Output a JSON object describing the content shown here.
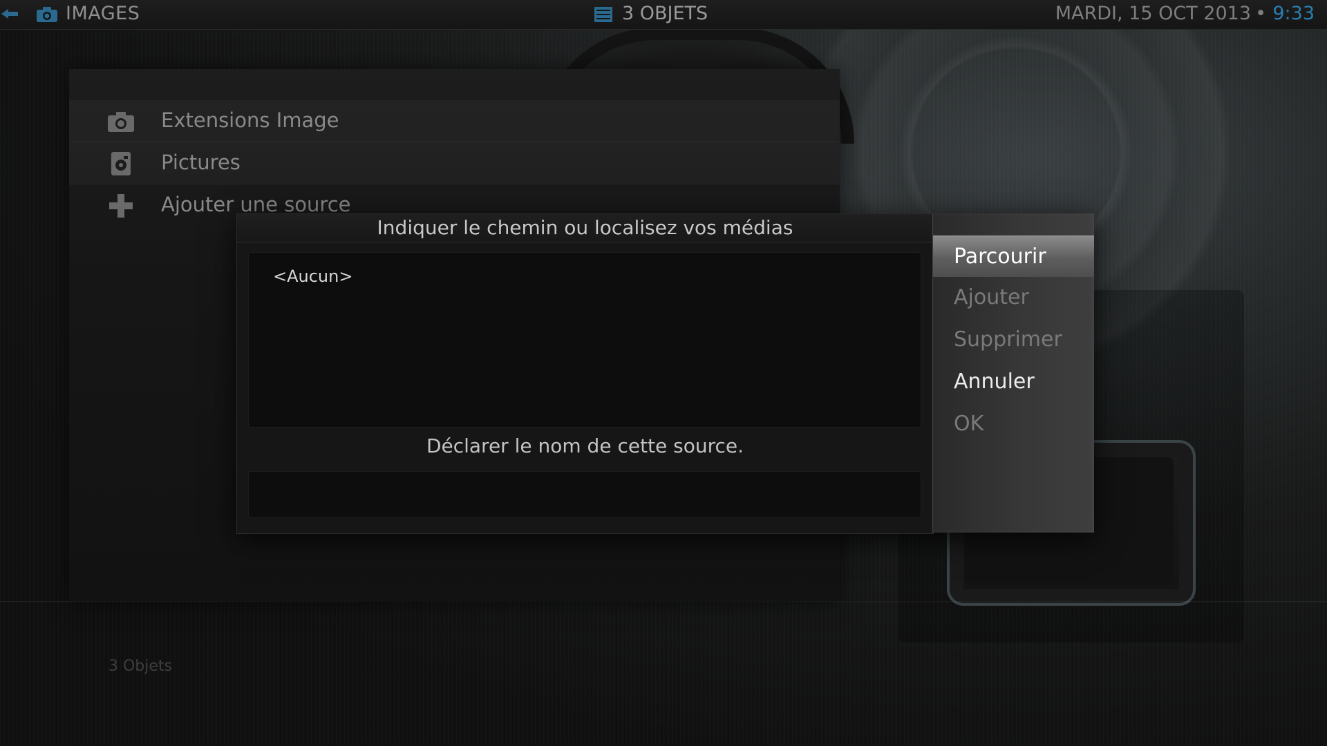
{
  "header": {
    "section_title": "IMAGES",
    "item_count": "3 OBJETS",
    "date": "MARDI, 15 OCT 2013",
    "separator": "•",
    "time": "9:33",
    "time_color": "#2a7fb0"
  },
  "source_list": {
    "items": [
      {
        "label": "Extensions Image",
        "icon": "camera-icon"
      },
      {
        "label": "Pictures",
        "icon": "picture-folder-icon"
      },
      {
        "label": "Ajouter une source",
        "icon": "plus-icon"
      }
    ],
    "footer": "3 Objets"
  },
  "dialog": {
    "title": "Indiquer le chemin ou localisez vos médias",
    "paths": [
      "<Aucun>"
    ],
    "name_prompt": "Déclarer le nom de cette source.",
    "name_value": "",
    "buttons": [
      {
        "label": "Parcourir",
        "state": "focused"
      },
      {
        "label": "Ajouter",
        "state": "disabled"
      },
      {
        "label": "Supprimer",
        "state": "disabled"
      },
      {
        "label": "Annuler",
        "state": "enabled"
      },
      {
        "label": "OK",
        "state": "disabled"
      }
    ]
  }
}
